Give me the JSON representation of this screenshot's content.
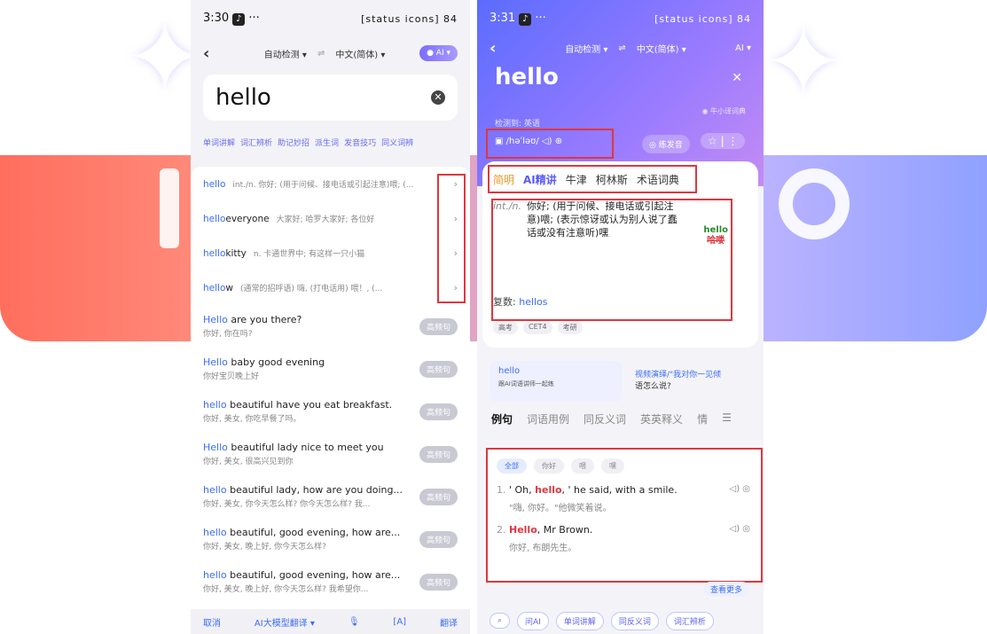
{
  "left": {
    "status": {
      "time": "3:30",
      "icons": "[status icons] 84"
    },
    "topbar": {
      "source_lang": "自动检测",
      "target_lang": "中文(简体)",
      "ai": "AI"
    },
    "search": {
      "query": "hello"
    },
    "chips": [
      "单词讲解",
      "词汇辨析",
      "助记妙招",
      "派生词",
      "发音技巧",
      "同义词辨"
    ],
    "suggestions": [
      {
        "head": "hello",
        "rest": "",
        "def": "int./n. 你好; (用于问候、接电话或引起注意)喂; (..."
      },
      {
        "head": "hello",
        "rest": " everyone",
        "def": "大家好; 哈罗大家好; 各位好"
      },
      {
        "head": "hello",
        "rest": " kitty",
        "def": "n. 卡通世界中; 有这样一只小猫"
      },
      {
        "head": "hello",
        "rest": "w",
        "def": "(通常的招呼语) 嗨, (打电话用) 喂！, (..."
      }
    ],
    "examples": [
      {
        "head": "Hello",
        "rest": " are you there?",
        "cn": "你好, 你在吗?"
      },
      {
        "head": "Hello",
        "rest": " baby good evening",
        "cn": "你好宝贝晚上好"
      },
      {
        "head": "hello",
        "rest": " beautiful have you eat breakfast.",
        "cn": "你好, 美女, 你吃早餐了吗。"
      },
      {
        "head": "Hello",
        "rest": " beautiful lady nice to meet you",
        "cn": "你好, 美女, 很高兴见到你"
      },
      {
        "head": "hello",
        "rest": " beautiful lady, how are you doing...",
        "cn": "你好, 美女, 你今天怎么样? 你今天怎么样? 我..."
      },
      {
        "head": "hello",
        "rest": " beautiful, good evening, how are...",
        "cn": "你好, 美女, 晚上好, 你今天怎么样?"
      },
      {
        "head": "hello",
        "rest": " beautiful, good evening, how are...",
        "cn": "你好, 美女, 晚上好, 你今天怎么样? 我希望你..."
      }
    ],
    "tag": "高频句",
    "bottom": {
      "cancel": "取消",
      "model": "AI大模型翻译",
      "translate": "翻译"
    }
  },
  "right": {
    "status": {
      "time": "3:31",
      "icons": "[status icons] 84"
    },
    "topbar": {
      "source_lang": "自动检测",
      "target_lang": "中文(简体)",
      "ai": "AI"
    },
    "word": "hello",
    "source": "牛小译词典",
    "detected": "检测到: 英语",
    "phonetic": "/həˈləʊ/",
    "practice": "练发音",
    "dict_tabs": [
      "简明",
      "AI精讲",
      "牛津",
      "柯林斯",
      "术语词典"
    ],
    "definition": {
      "pos": "int./n.",
      "text": "你好; (用于问候、接电话或引起注意)喂; (表示惊讶或认为别人说了蠢话或没有注意听)嘿"
    },
    "doodle": {
      "en": "hello",
      "cn": "哈喽"
    },
    "plural_label": "复数:",
    "plural": "hellos",
    "exams": [
      "高考",
      "CET4",
      "考研"
    ],
    "video": {
      "word": "hello",
      "sub": "跟AI词语讲师一起练",
      "title": "视频演绎/\"我对你一见倾",
      "title2": "语怎么说?"
    },
    "sections": [
      "例句",
      "词语用例",
      "同反义词",
      "英英释义",
      "情"
    ],
    "filters": [
      "全部",
      "你好",
      "喂",
      "嘿"
    ],
    "sentences": [
      {
        "num": "1.",
        "pre": "' Oh, ",
        "hl": "hello",
        "post": ", ' he said, with a smile.",
        "cn": "\"嗨, 你好。\"他微笑着说。"
      },
      {
        "num": "2.",
        "pre": "",
        "hl": "Hello",
        "post": ", Mr Brown.",
        "cn": "你好, 布朗先生。"
      }
    ],
    "more": "查看更多",
    "bottom": [
      "问AI",
      "单词讲解",
      "同反义词",
      "词汇辨析"
    ]
  }
}
